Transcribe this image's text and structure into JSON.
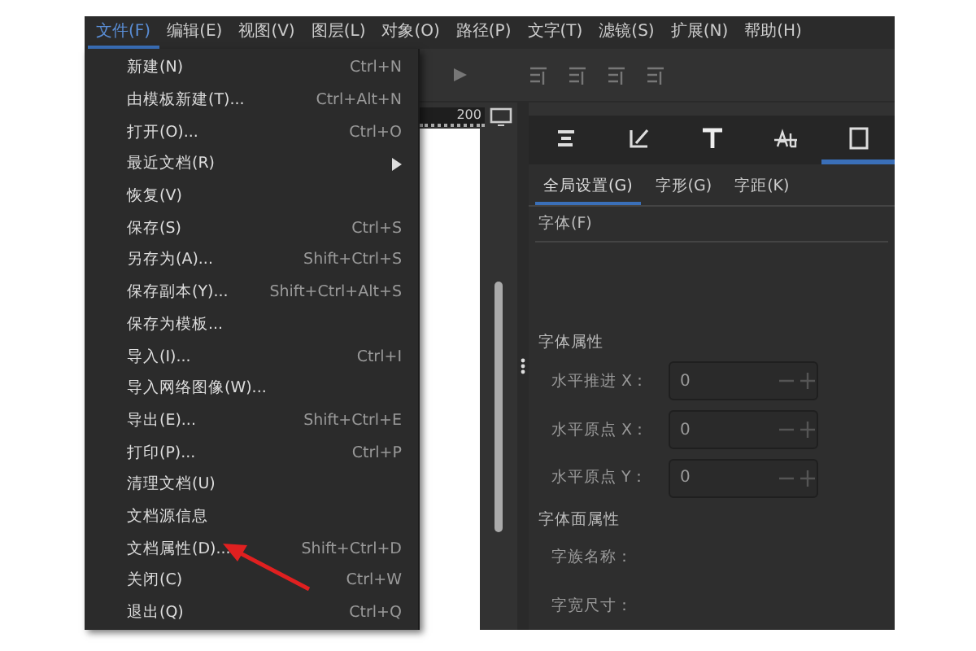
{
  "menubar": [
    {
      "label": "文件(F)",
      "selected": true
    },
    {
      "label": "编辑(E)",
      "selected": false
    },
    {
      "label": "视图(V)",
      "selected": false
    },
    {
      "label": "图层(L)",
      "selected": false
    },
    {
      "label": "对象(O)",
      "selected": false
    },
    {
      "label": "路径(P)",
      "selected": false
    },
    {
      "label": "文字(T)",
      "selected": false
    },
    {
      "label": "滤镜(S)",
      "selected": false
    },
    {
      "label": "扩展(N)",
      "selected": false
    },
    {
      "label": "帮助(H)",
      "selected": false
    }
  ],
  "file_menu": [
    {
      "label": "新建(N)",
      "shortcut": "Ctrl+N",
      "kind": "item"
    },
    {
      "label": "由模板新建(T)...",
      "shortcut": "Ctrl+Alt+N",
      "kind": "item"
    },
    {
      "label": "打开(O)...",
      "shortcut": "Ctrl+O",
      "kind": "item"
    },
    {
      "label": "最近文档(R)",
      "kind": "submenu"
    },
    {
      "label": "恢复(V)",
      "kind": "item"
    },
    {
      "label": "保存(S)",
      "shortcut": "Ctrl+S",
      "kind": "item"
    },
    {
      "label": "另存为(A)...",
      "shortcut": "Shift+Ctrl+S",
      "kind": "item"
    },
    {
      "label": "保存副本(Y)...",
      "shortcut": "Shift+Ctrl+Alt+S",
      "kind": "item"
    },
    {
      "label": "保存为模板...",
      "kind": "item"
    },
    {
      "label": "导入(I)...",
      "shortcut": "Ctrl+I",
      "kind": "item"
    },
    {
      "label": "导入网络图像(W)...",
      "kind": "item"
    },
    {
      "label": "导出(E)...",
      "shortcut": "Shift+Ctrl+E",
      "kind": "item"
    },
    {
      "label": "打印(P)...",
      "shortcut": "Ctrl+P",
      "kind": "item"
    },
    {
      "label": "清理文档(U)",
      "kind": "item"
    },
    {
      "label": "文档源信息",
      "kind": "item"
    },
    {
      "label": "文档属性(D)...",
      "shortcut": "Shift+Ctrl+D",
      "kind": "item"
    },
    {
      "label": "关闭(C)",
      "shortcut": "Ctrl+W",
      "kind": "item"
    },
    {
      "label": "退出(Q)",
      "shortcut": "Ctrl+Q",
      "kind": "item"
    }
  ],
  "ruler": {
    "label": "200"
  },
  "panel": {
    "icon_tabs": [
      {
        "selected": false
      },
      {
        "selected": false
      },
      {
        "selected": false
      },
      {
        "selected": false
      },
      {
        "selected": true
      }
    ],
    "tabs": [
      {
        "label": "全局设置(G)",
        "selected": true
      },
      {
        "label": "字形(G)",
        "selected": false
      },
      {
        "label": "字距(K)",
        "selected": false
      }
    ],
    "font_label": "字体(F)",
    "sections": [
      {
        "title": "字体属性",
        "rows": [
          {
            "label": "水平推进 X：",
            "value": "0"
          },
          {
            "label": "水平原点 X：",
            "value": "0"
          },
          {
            "label": "水平原点 Y：",
            "value": "0"
          }
        ]
      },
      {
        "title": "字体面属性",
        "rows": [
          {
            "label": "字族名称："
          },
          {
            "label": "字宽尺寸："
          }
        ]
      }
    ]
  }
}
